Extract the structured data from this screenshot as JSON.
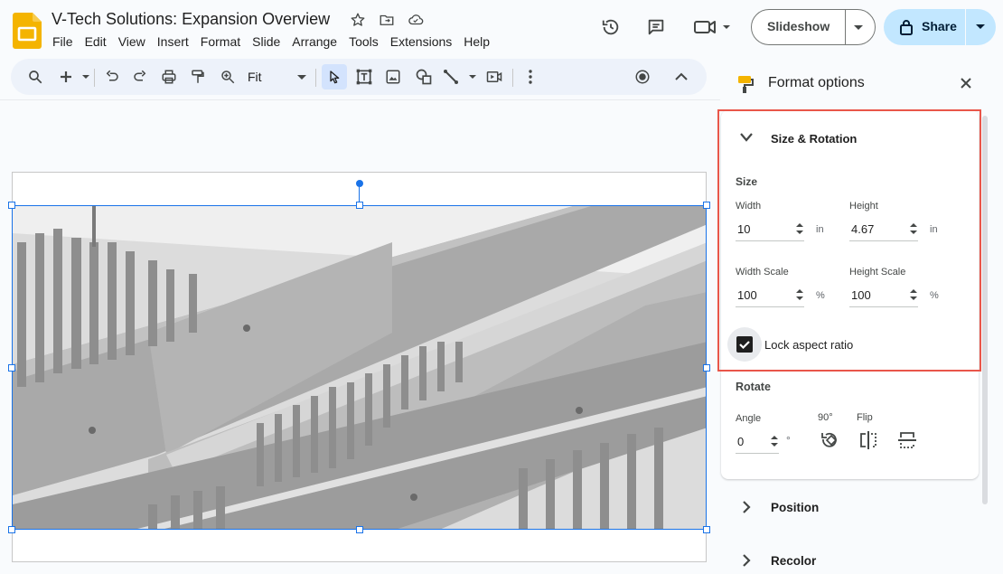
{
  "document": {
    "title": "V-Tech Solutions: Expansion Overview"
  },
  "menu": [
    "File",
    "Edit",
    "View",
    "Insert",
    "Format",
    "Slide",
    "Arrange",
    "Tools",
    "Extensions",
    "Help"
  ],
  "toolbar": {
    "zoom_value": "Fit"
  },
  "header_buttons": {
    "slideshow": "Slideshow",
    "share": "Share"
  },
  "panel": {
    "title": "Format options",
    "size_rotation": {
      "title": "Size & Rotation",
      "size_heading": "Size",
      "width_label": "Width",
      "width_value": "10",
      "height_label": "Height",
      "height_value": "4.67",
      "unit_in": "in",
      "width_scale_label": "Width Scale",
      "width_scale_value": "100",
      "height_scale_label": "Height Scale",
      "height_scale_value": "100",
      "unit_pct": "%",
      "lock_label": "Lock aspect ratio",
      "lock_checked": true
    },
    "rotate": {
      "heading": "Rotate",
      "angle_label": "Angle",
      "angle_value": "0",
      "degree_symbol": "°",
      "rotate90_label": "90°",
      "flip_label": "Flip"
    },
    "sections": [
      "Position",
      "Recolor"
    ]
  },
  "colors": {
    "accent": "#1a73e8",
    "highlight": "#e9564a",
    "share_bg": "#c2e7ff",
    "toolbar_bg": "#edf2fa"
  }
}
